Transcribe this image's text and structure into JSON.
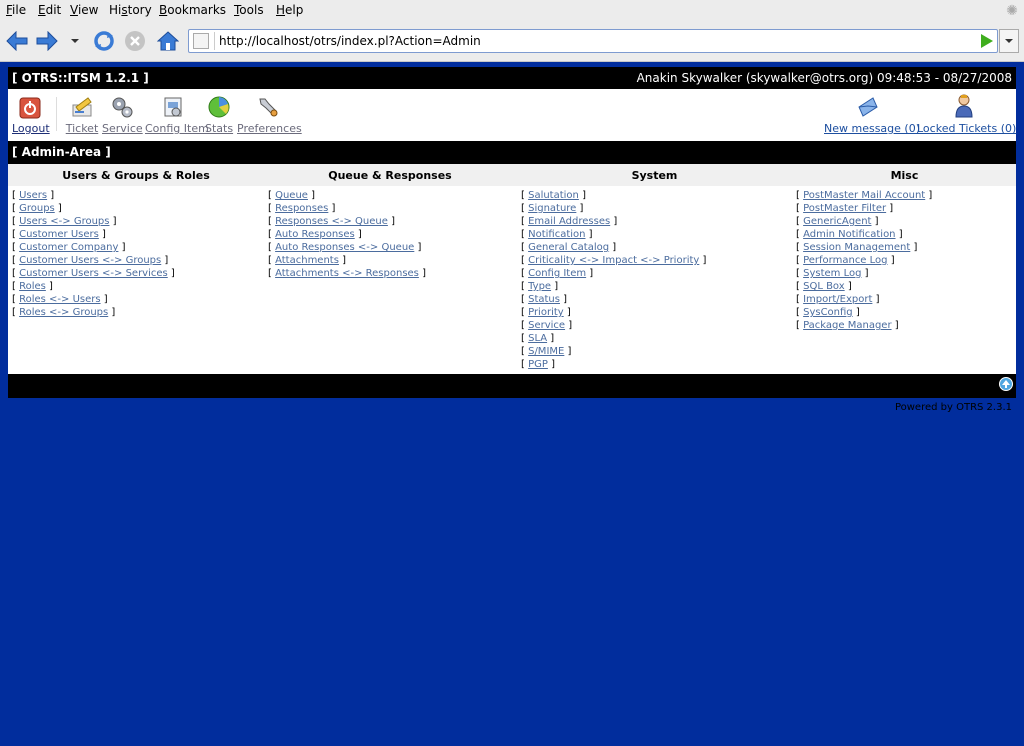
{
  "browser": {
    "menu": [
      {
        "key": "F",
        "rest": "ile"
      },
      {
        "key": "E",
        "rest": "dit"
      },
      {
        "key": "V",
        "rest": "iew"
      },
      {
        "pre": "Hi",
        "key": "s",
        "rest": "tory"
      },
      {
        "key": "B",
        "rest": "ookmarks"
      },
      {
        "key": "T",
        "rest": "ools"
      },
      {
        "key": "H",
        "rest": "elp"
      }
    ],
    "url": "http://localhost/otrs/index.pl?Action=Admin"
  },
  "header": {
    "title": "[ OTRS::ITSM 1.2.1 ]",
    "user_info": "Anakin Skywalker (skywalker@otrs.org) 09:48:53 - 08/27/2008"
  },
  "nav": {
    "logout": "Logout",
    "ticket": "Ticket",
    "service": "Service",
    "config_item": "Config Item",
    "stats": "Stats",
    "preferences": "Preferences",
    "new_message": "New message (0)",
    "locked_tickets": "Locked Tickets (0)"
  },
  "admin_area_title": "[ Admin-Area ]",
  "columns": [
    {
      "heading": "Users & Groups & Roles",
      "items": [
        "Users",
        "Groups",
        "Users <-> Groups",
        "Customer Users",
        "Customer Company",
        "Customer Users <-> Groups",
        "Customer Users <-> Services",
        "Roles",
        "Roles <-> Users",
        "Roles <-> Groups"
      ]
    },
    {
      "heading": "Queue & Responses",
      "items": [
        "Queue",
        "Responses",
        "Responses <-> Queue",
        "Auto Responses",
        "Auto Responses <-> Queue",
        "Attachments",
        "Attachments <-> Responses"
      ]
    },
    {
      "heading": "System",
      "items": [
        "Salutation",
        "Signature",
        "Email Addresses",
        "Notification",
        "General Catalog",
        "Criticality <-> Impact <-> Priority",
        "Config Item",
        "Type",
        "Status",
        "Priority",
        "Service",
        "SLA",
        "S/MIME",
        "PGP"
      ]
    },
    {
      "heading": "Misc",
      "items": [
        "PostMaster Mail Account",
        "PostMaster Filter",
        "GenericAgent",
        "Admin Notification",
        "Session Management",
        "Performance Log",
        "System Log",
        "SQL Box",
        "Import/Export",
        "SysConfig",
        "Package Manager"
      ]
    }
  ],
  "powered_by": "Powered by OTRS 2.3.1",
  "colors": {
    "page_bg": "#012d9d",
    "bar_bg": "#000000",
    "link": "#4b6c9e",
    "chrome": "#ececec"
  }
}
